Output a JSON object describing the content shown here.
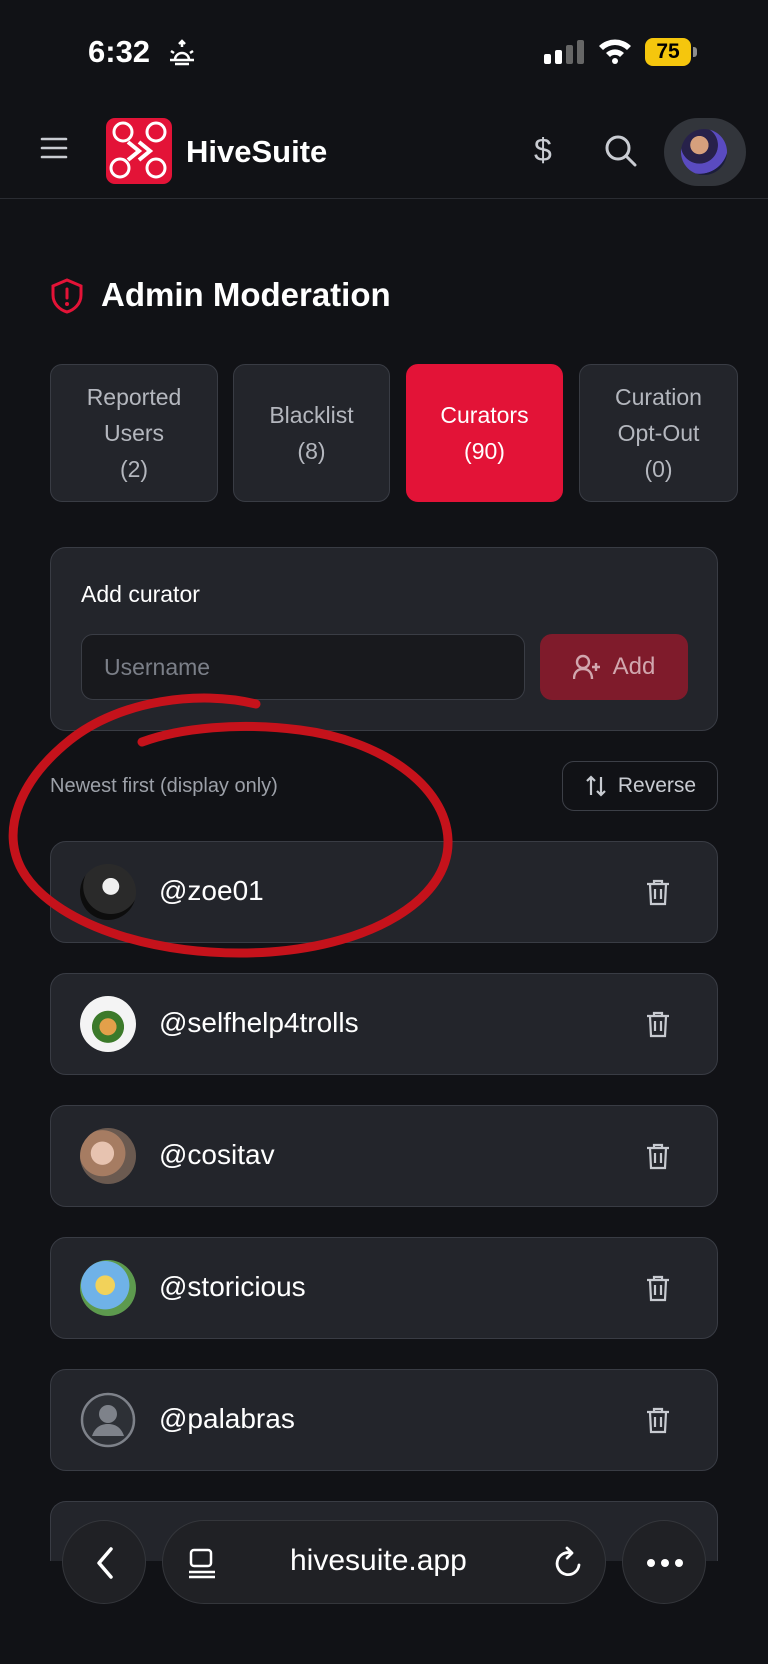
{
  "status_bar": {
    "time": "6:32",
    "battery": "75"
  },
  "header": {
    "brand": "HiveSuite",
    "currency_symbol": "$",
    "icons": [
      "menu-icon",
      "hivesuite-logo",
      "dollar-icon",
      "search-icon",
      "avatar"
    ]
  },
  "page": {
    "title": "Admin Moderation",
    "accent": "#e31337"
  },
  "tabs": [
    {
      "label_lines": [
        "Reported",
        "Users",
        "(2)"
      ],
      "active": false
    },
    {
      "label_lines": [
        "Blacklist",
        "(8)"
      ],
      "active": false
    },
    {
      "label_lines": [
        "Curators",
        "(90)"
      ],
      "active": true
    },
    {
      "label_lines": [
        "Curation",
        "Opt-Out",
        "(0)"
      ],
      "active": false
    }
  ],
  "add_curator": {
    "title": "Add curator",
    "placeholder": "Username",
    "button_label": "Add"
  },
  "sort": {
    "label": "Newest first (display only)",
    "reverse_label": "Reverse"
  },
  "curators": [
    {
      "username": "@zoe01"
    },
    {
      "username": "@selfhelp4trolls"
    },
    {
      "username": "@cositav"
    },
    {
      "username": "@storicious"
    },
    {
      "username": "@palabras"
    }
  ],
  "browser": {
    "url": "hivesuite.app"
  },
  "annotation": {
    "color": "#c5121b"
  }
}
